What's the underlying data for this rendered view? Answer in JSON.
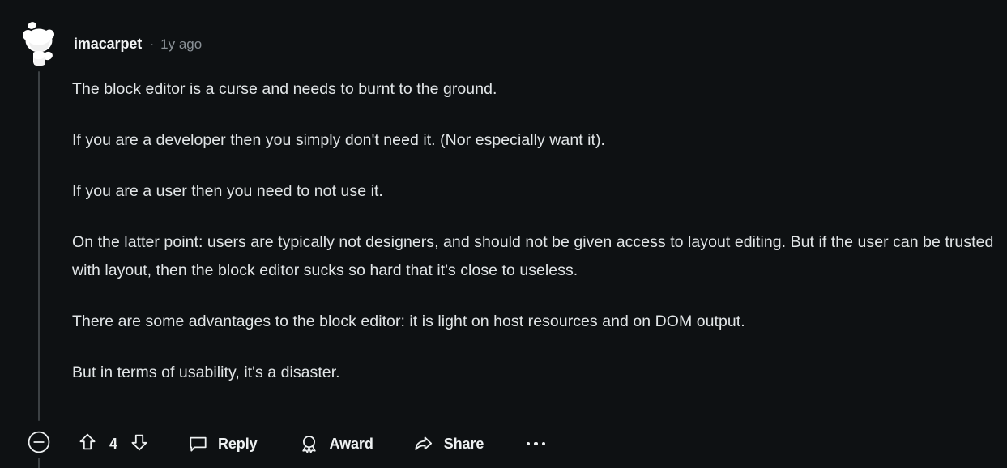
{
  "theme": {
    "background": "#0e1113",
    "text": "#e1e5e7",
    "muted": "#8a9197",
    "thread_line": "#3c4144"
  },
  "comment": {
    "author": "imacarpet",
    "meta_separator": "·",
    "timestamp": "1y ago",
    "avatar_icon": "snoo-avatar-icon",
    "paragraphs": [
      "The block editor is a curse and needs to burnt to the ground.",
      "If you are a developer then you simply don't need it. (Nor especially want it).",
      "If you are a user then you need to not use it.",
      "On the latter point: users are typically not designers, and should not be given access to layout editing. But if the user can be trusted with layout, then the block editor sucks so hard that it's close to useless.",
      "There are some advantages to the block editor: it is light on host resources and on DOM output.",
      "But in terms of usability, it's a disaster."
    ]
  },
  "actions": {
    "collapse": {
      "icon": "minus-circle-icon",
      "label": ""
    },
    "upvote": {
      "icon": "upvote-arrow-icon"
    },
    "vote_count": "4",
    "downvote": {
      "icon": "downvote-arrow-icon"
    },
    "reply": {
      "icon": "comment-bubble-icon",
      "label": "Reply"
    },
    "award": {
      "icon": "award-rosette-icon",
      "label": "Award"
    },
    "share": {
      "icon": "share-arrow-icon",
      "label": "Share"
    },
    "overflow": {
      "icon": "more-horizontal-icon",
      "label": ""
    }
  }
}
